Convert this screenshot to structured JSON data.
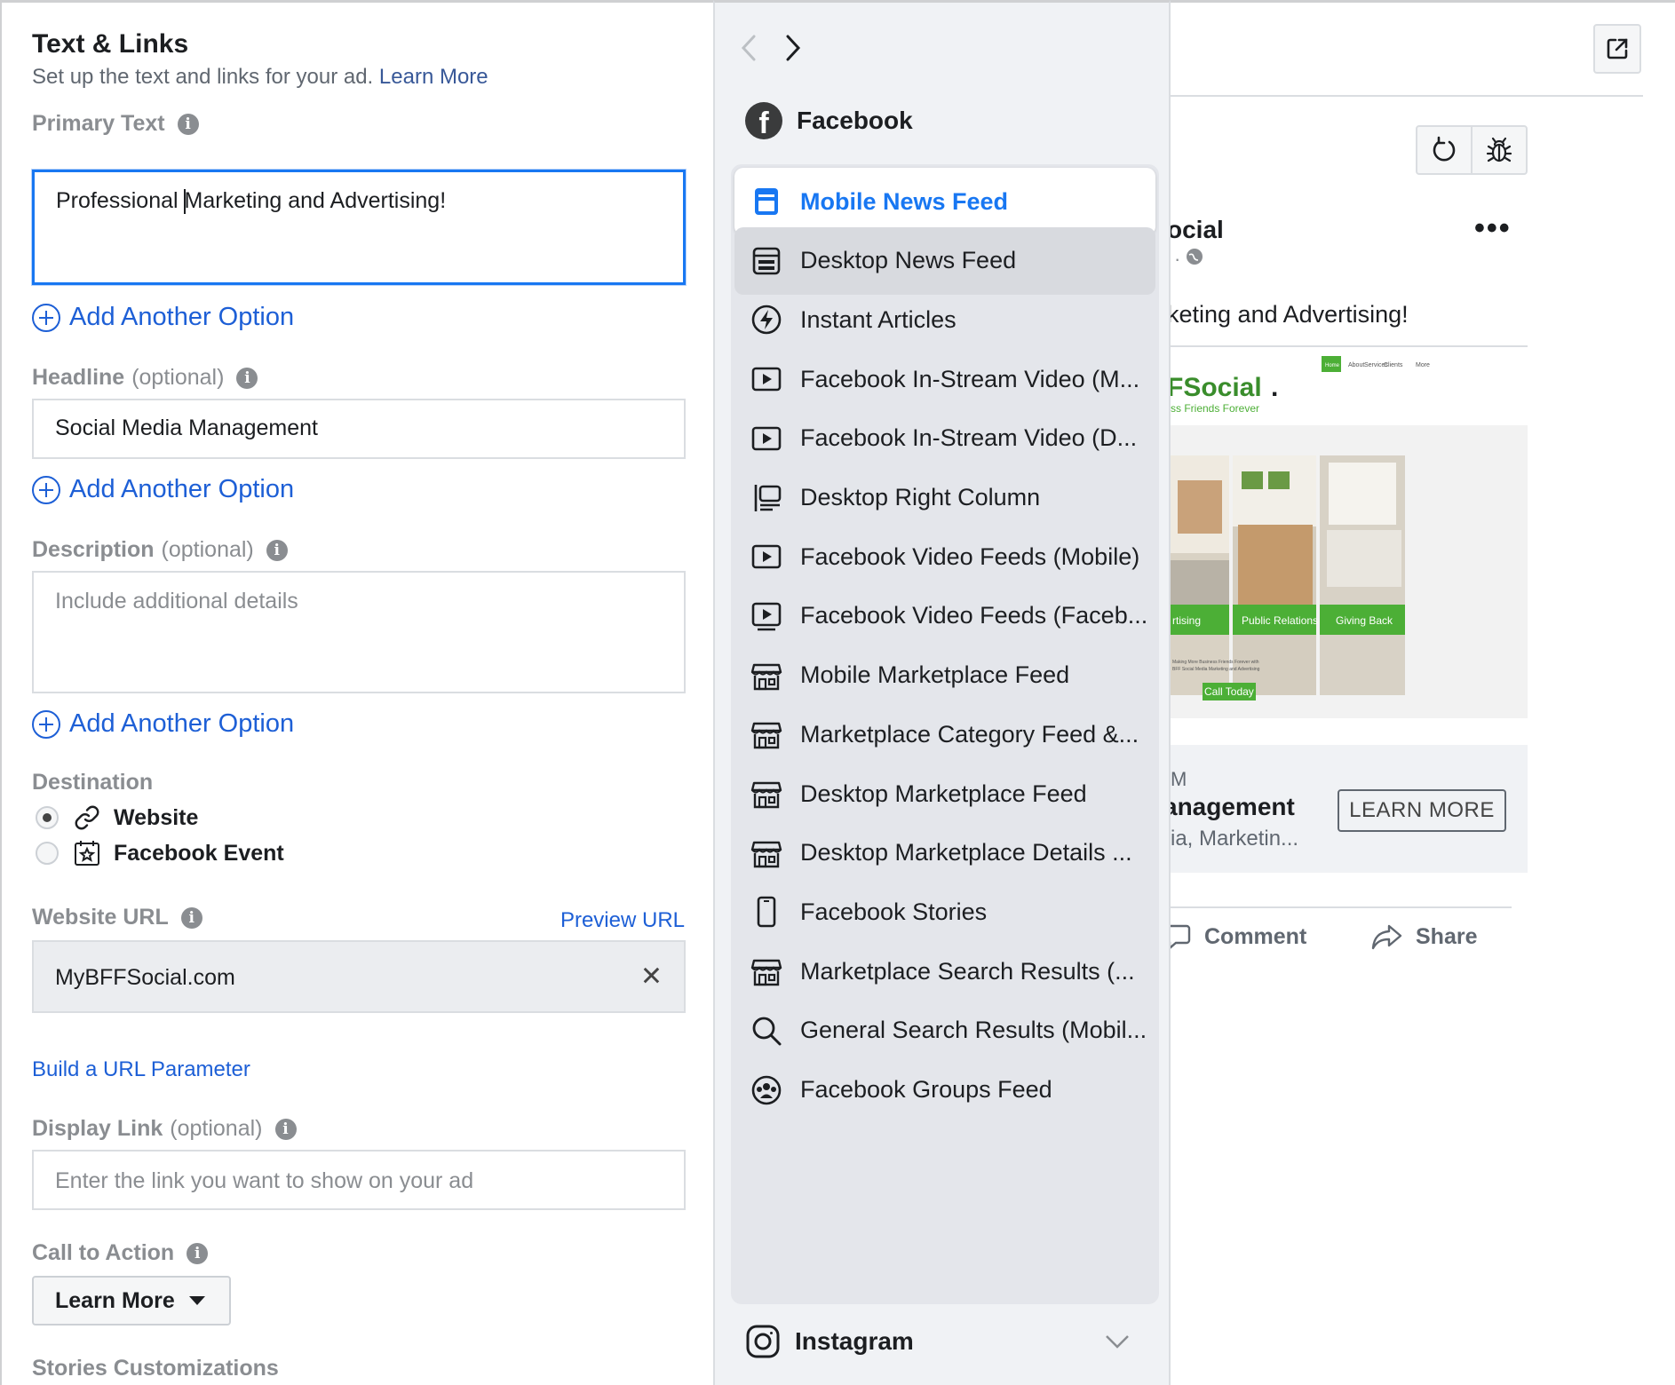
{
  "editor": {
    "title": "Text & Links",
    "subtitle": "Set up the text and links for your ad.",
    "learn_more_link": "Learn More",
    "primary_text": {
      "label": "Primary Text",
      "value_before_cursor": "Professional ",
      "value_after_cursor": "Marketing and Advertising!"
    },
    "add_option_label": "Add Another Option",
    "headline": {
      "label": "Headline",
      "optional": "(optional)",
      "value": "Social Media Management"
    },
    "description": {
      "label": "Description",
      "optional": "(optional)",
      "placeholder": "Include additional details"
    },
    "destination": {
      "label": "Destination",
      "options": [
        {
          "label": "Website",
          "selected": true,
          "icon": "link-icon"
        },
        {
          "label": "Facebook Event",
          "selected": false,
          "icon": "event-star-icon"
        }
      ]
    },
    "website_url": {
      "label": "Website URL",
      "preview_link": "Preview URL",
      "value": "MyBFFSocial.com"
    },
    "build_url_param": "Build a URL Parameter",
    "display_link": {
      "label": "Display Link",
      "optional": "(optional)",
      "placeholder": "Enter the link you want to show on your ad"
    },
    "call_to_action": {
      "label": "Call to Action",
      "value": "Learn More"
    },
    "stories_label": "Stories Customizations"
  },
  "placements": {
    "facebook_header": "Facebook",
    "items": [
      {
        "label": "Mobile News Feed",
        "icon": "mobile-feed-icon",
        "state": "selected"
      },
      {
        "label": "Desktop News Feed",
        "icon": "desktop-feed-icon",
        "state": "hover"
      },
      {
        "label": "Instant Articles",
        "icon": "lightning-icon",
        "state": ""
      },
      {
        "label": "Facebook In-Stream Video (M...",
        "icon": "play-icon",
        "state": ""
      },
      {
        "label": "Facebook In-Stream Video (D...",
        "icon": "play-icon",
        "state": ""
      },
      {
        "label": "Desktop Right Column",
        "icon": "right-column-icon",
        "state": ""
      },
      {
        "label": "Facebook Video Feeds (Mobile)",
        "icon": "play-icon",
        "state": ""
      },
      {
        "label": "Facebook Video Feeds (Faceb...",
        "icon": "play-stand-icon",
        "state": ""
      },
      {
        "label": "Mobile Marketplace Feed",
        "icon": "store-icon",
        "state": ""
      },
      {
        "label": "Marketplace Category Feed &...",
        "icon": "store-icon",
        "state": ""
      },
      {
        "label": "Desktop Marketplace Feed",
        "icon": "store-icon",
        "state": ""
      },
      {
        "label": "Desktop Marketplace Details ...",
        "icon": "store-icon",
        "state": ""
      },
      {
        "label": "Facebook Stories",
        "icon": "phone-icon",
        "state": ""
      },
      {
        "label": "Marketplace Search Results (...",
        "icon": "store-icon",
        "state": ""
      },
      {
        "label": "General Search Results (Mobil...",
        "icon": "search-icon",
        "state": ""
      },
      {
        "label": "Facebook Groups Feed",
        "icon": "groups-icon",
        "state": ""
      }
    ],
    "instagram_header": "Instagram"
  },
  "preview": {
    "page_name": "ocial",
    "page_meta": "· ",
    "post_text": "keting and Advertising!",
    "image": {
      "brand": "FSocial",
      "brand_dot": ".",
      "tagline": "ss Friends Forever",
      "nav": [
        "Home",
        "About",
        "Services",
        "Clients",
        "More"
      ],
      "tiles": [
        "rtising",
        "Public Relations",
        "Giving Back"
      ],
      "fine_print_1": "Making More Business Friends Forever with",
      "fine_print_2": "BFF Social Media Marketing and Advertising",
      "call_today": "Call Today"
    },
    "caption_domain": "M",
    "caption_headline": "anagement",
    "caption_desc": "ia, Marketin...",
    "cta_button": "LEARN MORE",
    "comment_label": "Comment",
    "share_label": "Share"
  },
  "colors": {
    "accent_blue": "#1877f2",
    "link_blue": "#1d5fd6",
    "brand_green": "#4caf36"
  }
}
